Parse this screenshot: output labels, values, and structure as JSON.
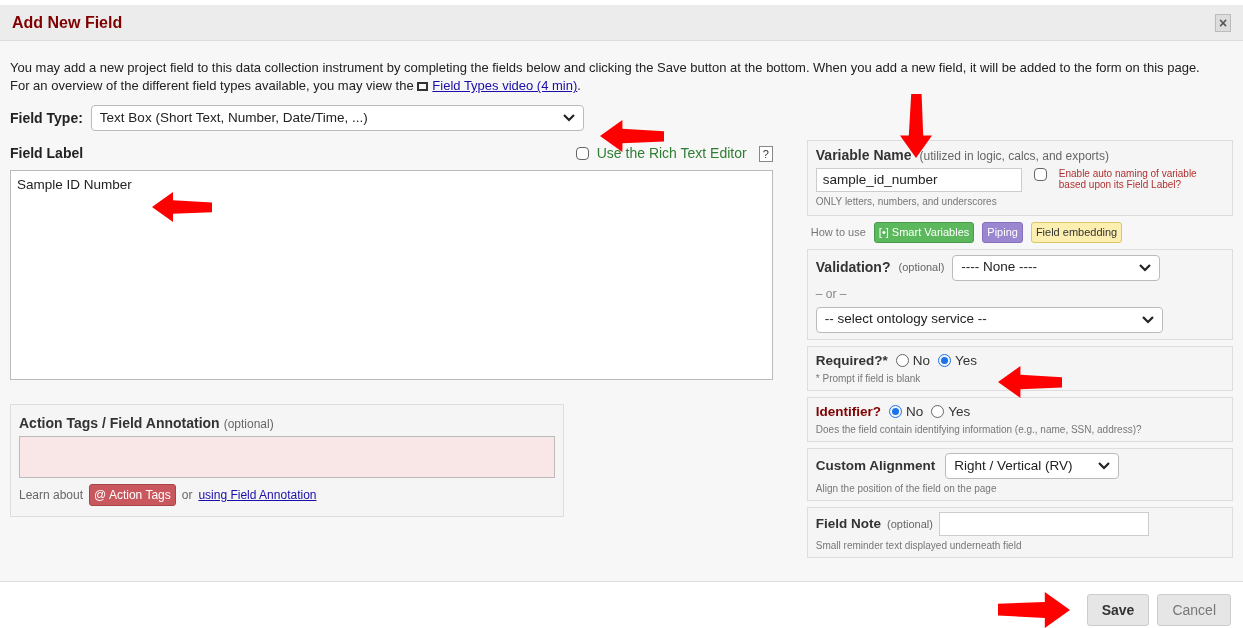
{
  "dialog": {
    "title": "Add New Field",
    "close": "×"
  },
  "intro": {
    "text": "You may add a new project field to this data collection instrument by completing the fields below and clicking the Save button at the bottom. When you add a new field, it will be added to the form on this page. For an overview of the different field types available, you may view the",
    "link": "Field Types video (4 min)",
    "after": "."
  },
  "field_type": {
    "label": "Field Type:",
    "value": "Text Box (Short Text, Number, Date/Time, ...)"
  },
  "field_label": {
    "label": "Field Label",
    "rich_text": {
      "label": "Use the Rich Text Editor",
      "checked": false
    },
    "help": "?",
    "value": "Sample ID Number"
  },
  "action_tags": {
    "label": "Action Tags / Field Annotation",
    "optional": "(optional)",
    "learn": "Learn about",
    "tag_button": "@ Action Tags",
    "or": "or",
    "link": "using Field Annotation"
  },
  "variable_name": {
    "label": "Variable Name",
    "hint": "(utilized in logic, calcs, and exports)",
    "value": "sample_id_number",
    "note": "ONLY letters, numbers, and underscores",
    "auto_naming": {
      "label": "Enable auto naming of variable based upon its Field Label?",
      "checked": false
    }
  },
  "how_to_use": {
    "label": "How to use",
    "badges": [
      {
        "kind": "smart",
        "text": "[•] Smart Variables"
      },
      {
        "kind": "piping",
        "text": "Piping"
      },
      {
        "kind": "embedding",
        "text": "Field embedding"
      }
    ]
  },
  "validation": {
    "label": "Validation?",
    "optional": "(optional)",
    "value": "---- None ----",
    "or": "– or –",
    "ontology": "-- select ontology service --"
  },
  "required": {
    "label": "Required?*",
    "options": [
      {
        "label": "No",
        "selected": false
      },
      {
        "label": "Yes",
        "selected": true
      }
    ],
    "note": "* Prompt if field is blank"
  },
  "identifier": {
    "label": "Identifier?",
    "options": [
      {
        "label": "No",
        "selected": true
      },
      {
        "label": "Yes",
        "selected": false
      }
    ],
    "note": "Does the field contain identifying information (e.g., name, SSN, address)?"
  },
  "custom_alignment": {
    "label": "Custom Alignment",
    "value": "Right / Vertical (RV)",
    "note": "Align the position of the field on the page"
  },
  "field_note": {
    "label": "Field Note",
    "optional": "(optional)",
    "note": "Small reminder text displayed underneath field"
  },
  "buttons": [
    {
      "kind": "primary",
      "label": "Save"
    },
    {
      "kind": "secondary",
      "label": "Cancel"
    }
  ]
}
